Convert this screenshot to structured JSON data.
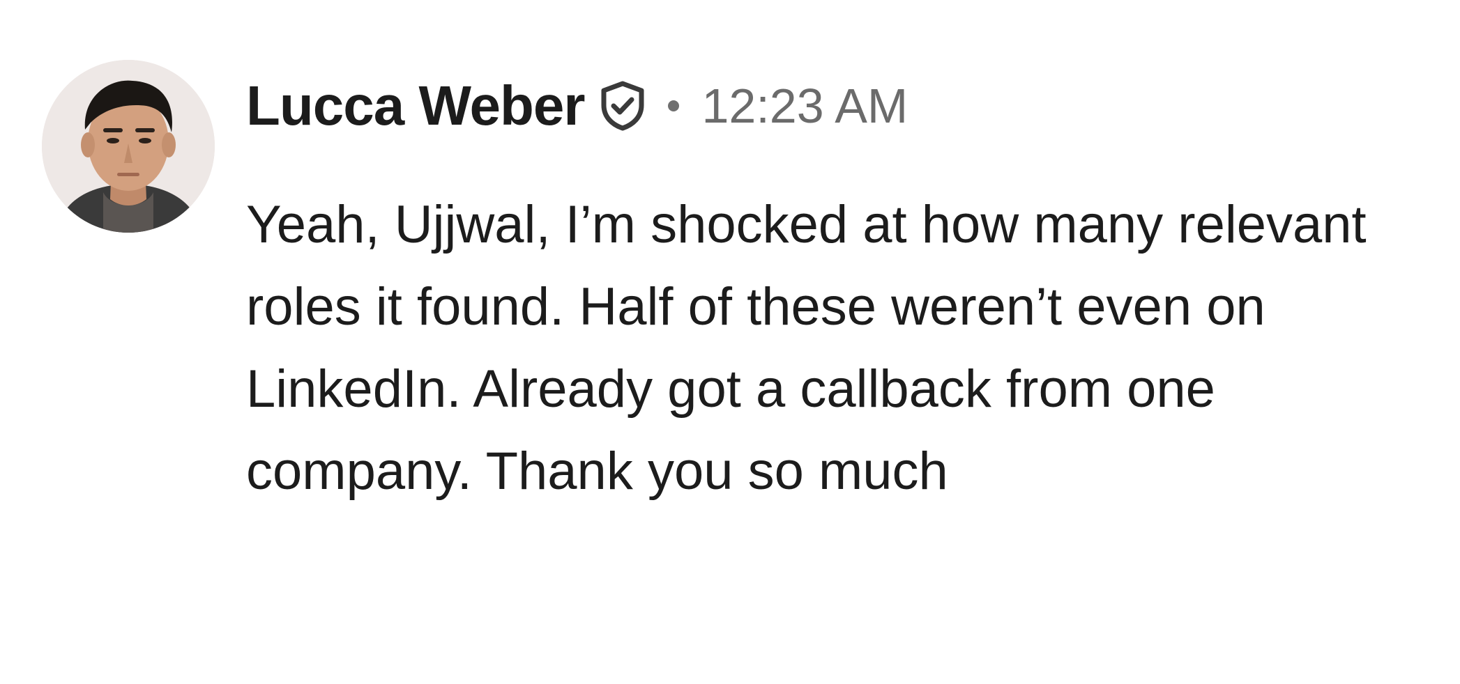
{
  "message": {
    "author": "Lucca Weber",
    "verified_icon": "verified-shield-check-icon",
    "separator": "•",
    "timestamp": "12:23 AM",
    "text": "Yeah, Ujjwal, I’m shocked at how many relevant roles it found. Half of these weren’t even on LinkedIn. Already got a callback from one company. Thank you so much"
  },
  "colors": {
    "author": "#1c1c1c",
    "timestamp": "#6b6b6b",
    "body": "#1c1c1c",
    "background": "#ffffff"
  }
}
